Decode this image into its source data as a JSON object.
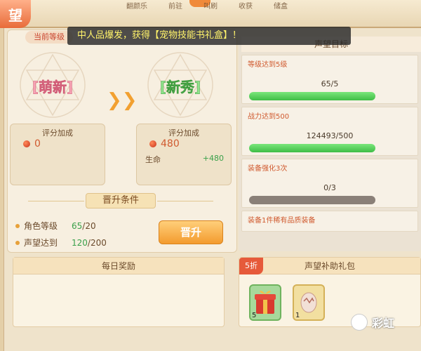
{
  "header": {
    "title_char": "望",
    "top_tabs": [
      "翻颜乐",
      "前驻",
      "叫刷",
      "收获",
      "储盒"
    ]
  },
  "notice": {
    "text": "中人品爆发，获得【宠物技能书礼盒】！"
  },
  "current": {
    "label": "当前等级"
  },
  "ranks": {
    "current": "[萌新]",
    "next": "[新秀]"
  },
  "bonus": {
    "left_title": "评分加成",
    "left_value": "0",
    "right_title": "评分加成",
    "right_value": "480",
    "hp_label": "生命",
    "hp_plus": "+480"
  },
  "conditions": {
    "header": "晋升条件",
    "role_level_label": "角色等级",
    "role_level_current": "65",
    "role_level_required": "/20",
    "fame_label": "声望达到",
    "fame_current": "120",
    "fame_required": "/200",
    "upgrade_button": "晋升"
  },
  "daily": {
    "title": "每日奖励"
  },
  "goals": {
    "title": "声望目标",
    "items": [
      {
        "label": "等级达到5级",
        "value": "65/5",
        "progress": 1.0
      },
      {
        "label": "战力达到500",
        "value": "124493/500",
        "progress": 1.0
      },
      {
        "label": "装备强化3次",
        "value": "0/3",
        "progress": 0.0
      },
      {
        "label": "装备1件稀有品质装备",
        "value": "",
        "progress": 0.0
      }
    ]
  },
  "gift": {
    "title": "声望补助礼包",
    "discount": "5折",
    "items": [
      {
        "icon": "gift-box-icon",
        "count": "5"
      },
      {
        "icon": "egg-icon",
        "count": "1"
      }
    ]
  },
  "watermark": {
    "text": "彩虹"
  },
  "colors": {
    "accent": "#f39b2e",
    "progress_green": "#3fbd46",
    "text_red": "#d05a2f",
    "green_text": "#3aa04a"
  }
}
